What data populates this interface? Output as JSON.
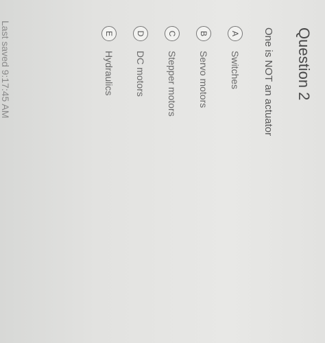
{
  "question": {
    "title": "Question 2",
    "prompt": "One is NOT an actuator"
  },
  "options": [
    {
      "letter": "A",
      "label": "Switches"
    },
    {
      "letter": "B",
      "label": "Servo motors"
    },
    {
      "letter": "C",
      "label": "Stepper motors"
    },
    {
      "letter": "D",
      "label": "DC motors"
    },
    {
      "letter": "E",
      "label": "Hydraulics"
    }
  ],
  "status": {
    "last_saved": "Last saved 9:17:45 AM"
  }
}
